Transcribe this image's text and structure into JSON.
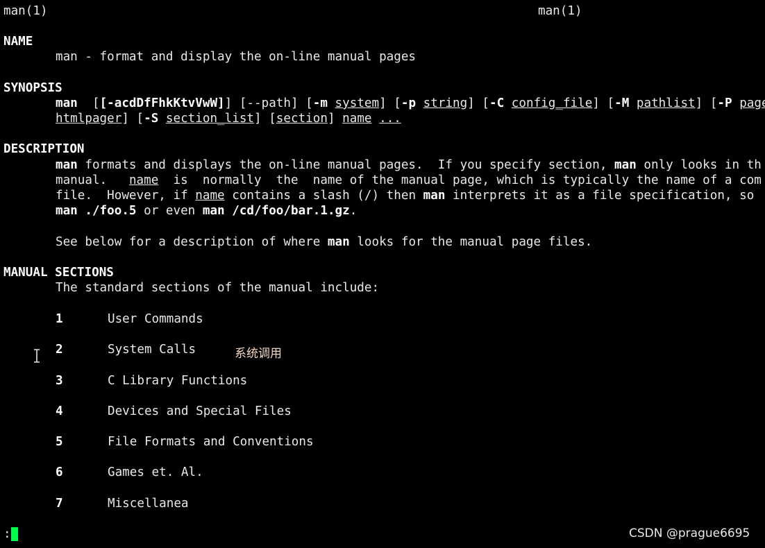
{
  "header": {
    "left": "man(1)",
    "right": "man(1)"
  },
  "name_section": {
    "heading": "NAME",
    "line": "man - format and display the on-line manual pages"
  },
  "synopsis": {
    "heading": "SYNOPSIS",
    "cmd": "man",
    "opt_flags": "[-acdDfFhkKtvVwW]",
    "path_flag": "[--path]",
    "m_flag": "-m",
    "m_arg": "system",
    "p_flag": "-p",
    "p_arg": "string",
    "C_flag": "-C",
    "C_arg": "config_file",
    "M_flag": "-M",
    "M_arg": "pathlist",
    "P_flag": "-P",
    "P_arg": "pager",
    "line2_htmlpager": "htmlpager",
    "S_flag": "-S",
    "S_arg": "section_list",
    "section_arg": "section",
    "name_arg": "name",
    "ellipsis": "..."
  },
  "description": {
    "heading": "DESCRIPTION",
    "l1_man": "man",
    "l1_text": " formats and displays the on-line manual pages.  If you specify section, ",
    "l1_man2": "man",
    "l1_tail": " only looks in th",
    "l2_a": "manual.   ",
    "l2_name": "name",
    "l2_b": "  is  normally  the  name of the manual page, which is typically the name of a com",
    "l3_a": "file.  However, if ",
    "l3_name": "name",
    "l3_b": " contains a slash (/) then ",
    "l3_man": "man",
    "l3_c": " interprets it as a file specification, so",
    "l4_a": "man ./foo.5",
    "l4_b": " or even ",
    "l4_c": "man /cd/foo/bar.1.gz",
    "l4_d": ".",
    "l5_a": "See below for a description of where ",
    "l5_man": "man",
    "l5_b": " looks for the manual page files."
  },
  "manual_sections": {
    "heading": "MANUAL SECTIONS",
    "intro": "The standard sections of the manual include:",
    "items": [
      {
        "num": "1",
        "label": "User Commands"
      },
      {
        "num": "2",
        "label": "System Calls"
      },
      {
        "num": "3",
        "label": "C Library Functions"
      },
      {
        "num": "4",
        "label": "Devices and Special Files"
      },
      {
        "num": "5",
        "label": "File Formats and Conventions"
      },
      {
        "num": "6",
        "label": "Games et. Al."
      },
      {
        "num": "7",
        "label": "Miscellanea"
      }
    ]
  },
  "annotation": "系统调用",
  "pager_prompt": ":",
  "watermark": "CSDN @prague6695",
  "colors": {
    "background": "#000000",
    "text": "#e8e8e8",
    "cursor": "#00ff4c",
    "annotation": "#f1d7c2"
  },
  "icons": {
    "mouse_cursor": "text-cursor-icon"
  }
}
